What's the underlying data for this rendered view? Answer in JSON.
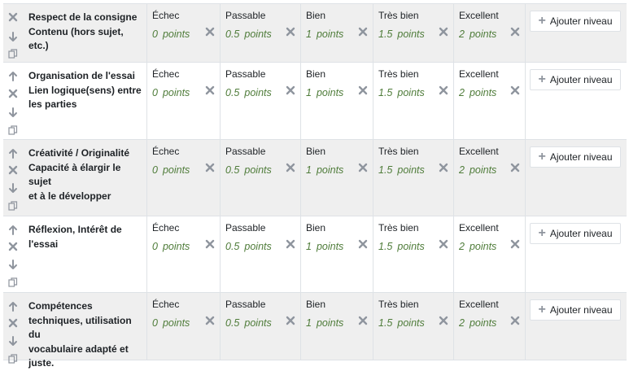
{
  "rubric": {
    "points_label": "points",
    "add_level_label": "Ajouter niveau",
    "criteria": [
      {
        "description_lines": [
          "Respect de la consigne",
          "Contenu (hors sujet, etc.)"
        ],
        "levels": [
          {
            "name": "Échec",
            "score": "0"
          },
          {
            "name": "Passable",
            "score": "0.5"
          },
          {
            "name": "Bien",
            "score": "1"
          },
          {
            "name": "Très bien",
            "score": "1.5"
          },
          {
            "name": "Excellent",
            "score": "2"
          }
        ]
      },
      {
        "description_lines": [
          "Organisation de l'essai",
          "Lien logique(sens) entre",
          "les parties"
        ],
        "levels": [
          {
            "name": "Échec",
            "score": "0"
          },
          {
            "name": "Passable",
            "score": "0.5"
          },
          {
            "name": "Bien",
            "score": "1"
          },
          {
            "name": "Très bien",
            "score": "1.5"
          },
          {
            "name": "Excellent",
            "score": "2"
          }
        ]
      },
      {
        "description_lines": [
          "Créativité / Originalité",
          "Capacité à élargir le sujet",
          "et à le développer"
        ],
        "levels": [
          {
            "name": "Échec",
            "score": "0"
          },
          {
            "name": "Passable",
            "score": "0.5"
          },
          {
            "name": "Bien",
            "score": "1"
          },
          {
            "name": "Très bien",
            "score": "1.5"
          },
          {
            "name": "Excellent",
            "score": "2"
          }
        ]
      },
      {
        "description_lines": [
          "Réflexion, Intérêt de",
          "l'essai"
        ],
        "levels": [
          {
            "name": "Échec",
            "score": "0"
          },
          {
            "name": "Passable",
            "score": "0.5"
          },
          {
            "name": "Bien",
            "score": "1"
          },
          {
            "name": "Très bien",
            "score": "1.5"
          },
          {
            "name": "Excellent",
            "score": "2"
          }
        ]
      },
      {
        "description_lines": [
          "Compétences",
          "techniques, utilisation du",
          "vocabulaire adapté et",
          "juste."
        ],
        "levels": [
          {
            "name": "Échec",
            "score": "0"
          },
          {
            "name": "Passable",
            "score": "0.5"
          },
          {
            "name": "Bien",
            "score": "1"
          },
          {
            "name": "Très bien",
            "score": "1.5"
          },
          {
            "name": "Excellent",
            "score": "2"
          }
        ]
      }
    ],
    "colors": {
      "shaded_row": "#efefef",
      "score_text": "#4f7c3a",
      "icon_grey": "#8f959e",
      "border": "#dee2e6"
    }
  }
}
